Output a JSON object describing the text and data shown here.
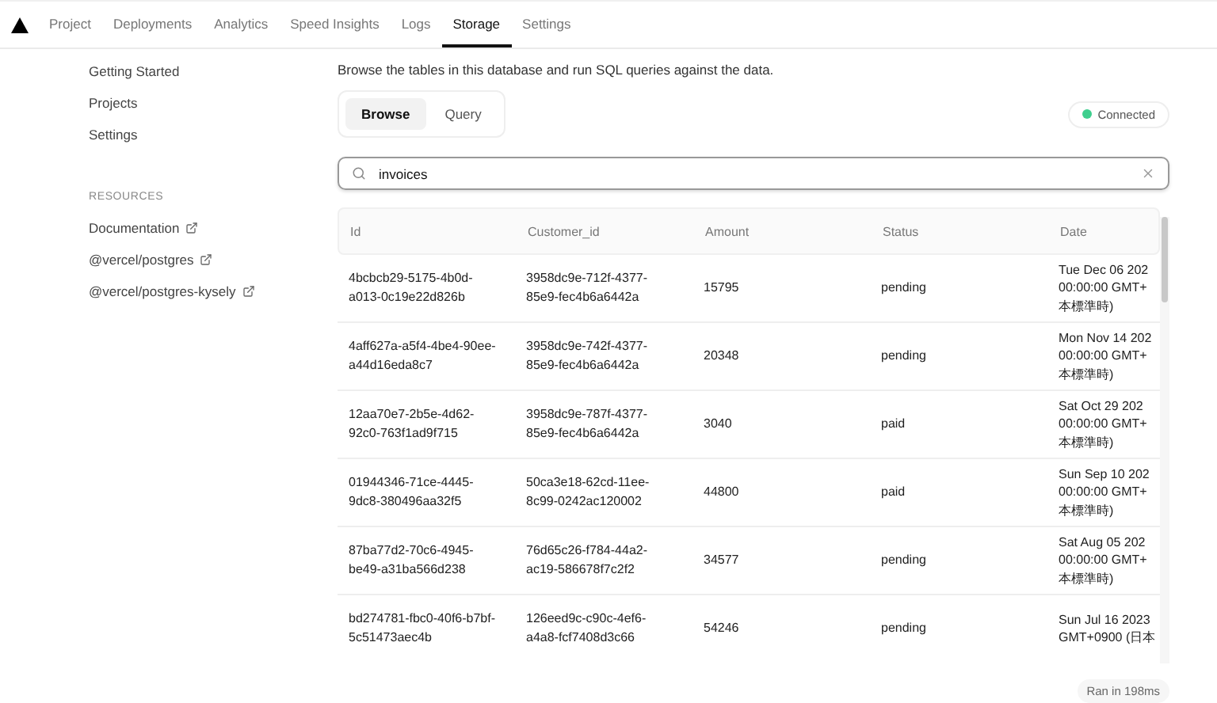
{
  "nav": {
    "tabs": [
      {
        "label": "Project",
        "selected": false
      },
      {
        "label": "Deployments",
        "selected": false
      },
      {
        "label": "Analytics",
        "selected": false
      },
      {
        "label": "Speed Insights",
        "selected": false
      },
      {
        "label": "Logs",
        "selected": false
      },
      {
        "label": "Storage",
        "selected": true
      },
      {
        "label": "Settings",
        "selected": false
      }
    ]
  },
  "sidebar": {
    "items": [
      {
        "label": "Getting Started",
        "external": false
      },
      {
        "label": "Projects",
        "external": false
      },
      {
        "label": "Settings",
        "external": false
      }
    ],
    "section_title": "RESOURCES",
    "resources": [
      {
        "label": "Documentation",
        "external": true
      },
      {
        "label": "@vercel/postgres",
        "external": true
      },
      {
        "label": "@vercel/postgres-kysely",
        "external": true
      }
    ]
  },
  "description": "Browse the tables in this database and run SQL queries against the data.",
  "mode_tabs": [
    {
      "label": "Browse",
      "selected": true
    },
    {
      "label": "Query",
      "selected": false
    }
  ],
  "status": {
    "label": "Connected",
    "color": "#3ecf8e"
  },
  "search": {
    "value": "invoices"
  },
  "table": {
    "columns": [
      "Id",
      "Customer_id",
      "Amount",
      "Status",
      "Date"
    ],
    "rows": [
      {
        "id": "4bcbcb29-5175-4b0d-a013-0c19e22d826b",
        "customer_id": "3958dc9e-712f-4377-85e9-fec4b6a6442a",
        "amount": "15795",
        "status": "pending",
        "date": [
          "Tue Dec 06 202",
          "00:00:00 GMT+",
          "本標準時)"
        ]
      },
      {
        "id": "4aff627a-a5f4-4be4-90ee-a44d16eda8c7",
        "customer_id": "3958dc9e-742f-4377-85e9-fec4b6a6442a",
        "amount": "20348",
        "status": "pending",
        "date": [
          "Mon Nov 14 202",
          "00:00:00 GMT+",
          "本標準時)"
        ]
      },
      {
        "id": "12aa70e7-2b5e-4d62-92c0-763f1ad9f715",
        "customer_id": "3958dc9e-787f-4377-85e9-fec4b6a6442a",
        "amount": "3040",
        "status": "paid",
        "date": [
          "Sat Oct 29 202",
          "00:00:00 GMT+",
          "本標準時)"
        ]
      },
      {
        "id": "01944346-71ce-4445-9dc8-380496aa32f5",
        "customer_id": "50ca3e18-62cd-11ee-8c99-0242ac120002",
        "amount": "44800",
        "status": "paid",
        "date": [
          "Sun Sep 10 202",
          "00:00:00 GMT+",
          "本標準時)"
        ]
      },
      {
        "id": "87ba77d2-70c6-4945-be49-a31ba566d238",
        "customer_id": "76d65c26-f784-44a2-ac19-586678f7c2f2",
        "amount": "34577",
        "status": "pending",
        "date": [
          "Sat Aug 05 202",
          "00:00:00 GMT+",
          "本標準時)"
        ]
      },
      {
        "id": "bd274781-fbc0-40f6-b7bf-5c51473aec4b",
        "customer_id": "126eed9c-c90c-4ef6-a4a8-fcf7408d3c66",
        "amount": "54246",
        "status": "pending",
        "date": [
          "Sun Jul 16 2023",
          "GMT+0900 (日本"
        ]
      }
    ]
  },
  "timing": "Ran in 198ms"
}
